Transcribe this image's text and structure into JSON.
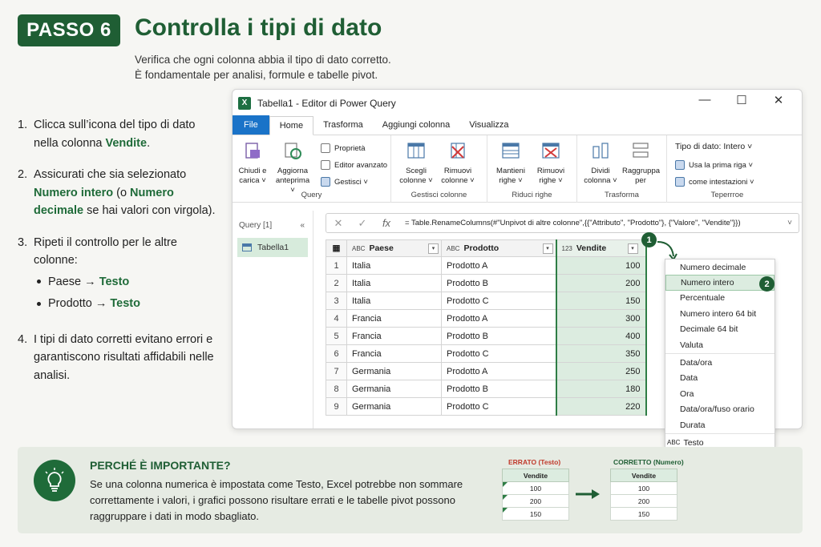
{
  "header": {
    "badge": "PASSO 6",
    "title": "Controlla i tipi di dato",
    "subtitle_line1": "Verifica che ogni colonna abbia il tipo di dato corretto.",
    "subtitle_line2": "È fondamentale per analisi, formule e tabelle pivot."
  },
  "steps": {
    "s1": {
      "n": "1.",
      "a": "Clicca sull’icona del tipo di dato nella colonna ",
      "b": "Vendite",
      "c": "."
    },
    "s2": {
      "n": "2.",
      "a": "Assicurati che sia selezionato ",
      "b": "Numero intero",
      "c": " (o ",
      "d": "Numero decimale",
      "e": " se hai valori con virgola)."
    },
    "s3": {
      "n": "3.",
      "a": "Ripeti il controllo per le altre colonne:",
      "b1a": "Paese → ",
      "b1b": "Testo",
      "b2a": "Prodotto → ",
      "b2b": "Testo"
    },
    "s4": {
      "n": "4.",
      "a": "I tipi di dato corretti evitano errori e garantiscono risultati affidabili nelle analisi."
    }
  },
  "window": {
    "title": "Tabella1 - Editor di Power Query",
    "tabs": [
      "File",
      "Home",
      "Trasforma",
      "Aggiungi colonna",
      "Visualizza"
    ],
    "ribbon": {
      "close_load": "Chiudi e carica ˅",
      "refresh": "Aggiorna anteprima ˅",
      "properties": "Proprietà",
      "adv_editor": "Editor avanzato",
      "manage": "Gestisci ˅",
      "group_query": "Query",
      "choose_cols": "Scegli colonne ˅",
      "remove_cols": "Rimuovi colonne ˅",
      "group_manage_cols": "Gestisci colonne",
      "keep_rows": "Mantieni righe ˅",
      "remove_rows": "Rimuovi righe ˅",
      "group_reduce": "Riduci righe",
      "split_col": "Dividi colonna ˅",
      "group_by": "Raggruppa per",
      "group_transform": "Trasforma",
      "datatype": "Tipo di dato: Intero ˅",
      "first_row": "Usa la prima riga ˅",
      "as_headers": "come intestazioni ˅",
      "group_last": "Teperrroe"
    },
    "queries_label": "Query [1]",
    "query_item": "Tabella1",
    "formula": "= Table.RenameColumns(#\"Unpivot di altre colonne\",{{\"Attributo\", \"Prodotto\"}, {\"Valore\", \"Vendite\"}})",
    "fx": "fx",
    "columns": [
      {
        "type": "ABC",
        "name": "Paese"
      },
      {
        "type": "ABC",
        "name": "Prodotto"
      },
      {
        "type": "123",
        "name": "Vendite"
      }
    ],
    "rows": [
      [
        "1",
        "Italia",
        "Prodotto A",
        "100"
      ],
      [
        "2",
        "Italia",
        "Prodotto B",
        "200"
      ],
      [
        "3",
        "Italia",
        "Prodotto C",
        "150"
      ],
      [
        "4",
        "Francia",
        "Prodotto A",
        "300"
      ],
      [
        "5",
        "Francia",
        "Prodotto B",
        "400"
      ],
      [
        "6",
        "Francia",
        "Prodotto C",
        "350"
      ],
      [
        "7",
        "Germania",
        "Prodotto A",
        "250"
      ],
      [
        "8",
        "Germania",
        "Prodotto B",
        "180"
      ],
      [
        "9",
        "Germania",
        "Prodotto C",
        "220"
      ]
    ],
    "menu": {
      "items1": [
        "Numero decimale",
        "Numero intero",
        "Percentuale",
        "Numero intero 64 bit",
        "Decimale 64 bit",
        "Valuta"
      ],
      "items2": [
        "Data/ora",
        "Data",
        "Ora",
        "Data/ora/fuso orario",
        "Durata"
      ],
      "text": "Testo",
      "selected": "Numero intero"
    },
    "markers": [
      "1",
      "2"
    ]
  },
  "bottom": {
    "title": "PERCHÉ È IMPORTANTE?",
    "text": "Se una colonna numerica è impostata come Testo, Excel potrebbe non sommare correttamente i valori, i grafici possono risultare errati e le tabelle pivot possono raggruppare i dati in modo sbagliato.",
    "wrong_label": "ERRATO (Testo)",
    "right_label": "CORRETTO (Numero)",
    "col": "Vendite",
    "values": [
      "100",
      "200",
      "150"
    ],
    "colors": {
      "wrong": "#c0392b",
      "right": "#1f5e34"
    }
  }
}
